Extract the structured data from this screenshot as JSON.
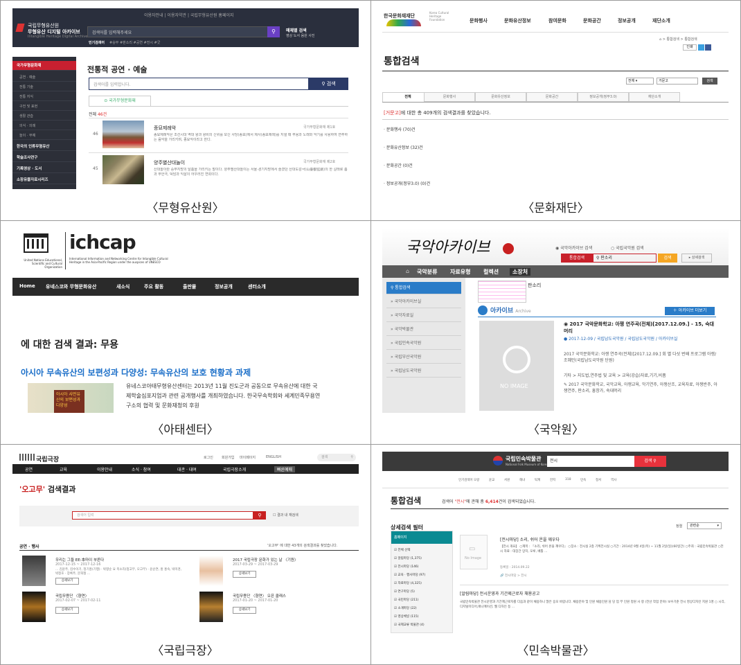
{
  "captions": {
    "p1": "〈무형유산원〉",
    "p2": "〈문화재단〉",
    "p3": "〈아태센터〉",
    "p4": "〈국악원〉",
    "p5": "〈국립극장〉",
    "p6": "〈민속박물관〉"
  },
  "p1": {
    "topbar": "이용자안내 | 이용자약관 | 국립무형유산원 홈페이지",
    "logo_line1": "국립무형유산원",
    "logo_line2": "무형유산 디지털 아카이브",
    "logo_line3": "Intangible Heritage Digital Archive",
    "search_placeholder": "검색어를 입력해주세요",
    "type_title": "매체별 검색",
    "type_items": "영상  도서  음원  사진",
    "popular_label": "인기검색어",
    "popular_items": "#승무  #판소리  #공연  #전시  #굿",
    "side_items": [
      "국가무형문화재",
      "공연 · 예술",
      "전통 기술",
      "전통 지식",
      "구전 및 표현",
      "생활 관습",
      "의식 · 의례",
      "놀이 · 무예",
      "한국의 인류무형유산",
      "학술조사연구",
      "기록영상 · 도서",
      "소장유물자료시리즈"
    ],
    "section_title": "전통적 공연 · 예술",
    "search2_placeholder": "검색어를 입력합니다.",
    "search2_button": "검색",
    "tab": "국가무형문화재",
    "total": "전체 46건",
    "item1_title": "종묘제례악",
    "item1_tag": "국가무형문화재 제1호",
    "item1_desc": "종묘제례악은 조선시대 역대 왕과 왕비의 신위를 모신 사당(종묘)에서 제사(종묘제례)를 지낼 때 무용과 노래와 악기를 사용하여 연주하는 음악을 가리키며, 종묘악이라고 한다.",
    "item1_num": "46",
    "item2_title": "양주별산대놀이",
    "item2_tag": "국가무형문화재 제2호",
    "item2_desc": "산대놀이란 중부지방의 탈춤을 가리키는 말이다. 양주별산대놀이는 서울·경기지방에서 즐겼던 산대도감극(山臺都監劇)의 한 갈래로 춤과 무언극, 덕담과 익살이 어우러진 연희이다.",
    "item2_num": "45"
  },
  "p2": {
    "logo": "한국문화재재단",
    "logo_sub": "Korea Cultural Heritage Foundation",
    "nav": [
      "문화행사",
      "문화유산정보",
      "참여문화",
      "문화공간",
      "정보공개",
      "재단소개"
    ],
    "breadcrumb": "통합검색 > 통합검색",
    "print": "인쇄",
    "title": "통합검색",
    "select": "전체",
    "query": "거문고",
    "search_button": "검색",
    "tabs": [
      "전체",
      "문화행사",
      "문화유산정보",
      "문화공간",
      "정보공개(정부3.0)",
      "재단소개"
    ],
    "result_prefix": "[거문고]",
    "result_text": "에 대한 총 409개의 검색결과를 찾았습니다.",
    "cats": [
      "문화행사 (70)건",
      "문화유산정보 (32)건",
      "문화공간 (0)건",
      "정보공개(정부3.0) (0)건"
    ]
  },
  "p3": {
    "unesco_caption": "United Nations Educational, Scientific and Cultural Organization",
    "logo": "ichcap",
    "logo_desc": "International Information and Networking Centre for Intangible Cultural Heritage in the Asia-Pacific Region under the auspices of UNESCO",
    "nav": [
      "Home",
      "유네스코와 무형문화유산",
      "새소식",
      "주요 활동",
      "출판물",
      "정보공개",
      "센터소개"
    ],
    "result": "에 대한 검색 결과: 무용",
    "article_title": "아시아 무속유산의 보편성과 다양성: 무속유산의 보호 현황과 과제",
    "article_text": "유네스코아태무형유산센터는 2013년 11월 진도군과 공동으로 무속유산에 대한 국제학술심포지엄과 관련 공개행사를 개최하였습니다. 한국무속학회와 세계민족무용연구소의 협력 및 문화재청의 후원",
    "thumb_text": "아시아 샤먼유산의 보편성과 다양성"
  },
  "p4": {
    "logo": "국악아카이브",
    "radio1": "국악아카이브 검색",
    "radio2": "국립국악원 검색",
    "search_label": "통합검색",
    "query": "판소리",
    "search_button": "검색",
    "detail_button": "상세검색",
    "nav": [
      "국악분류",
      "자료유형",
      "컬렉션",
      "소장처"
    ],
    "side": [
      "통합검색",
      "국악아카이브실",
      "국악자료실",
      "국악박물관",
      "국립민속국악원",
      "국립부산국악원",
      "국립남도국악원"
    ],
    "query_show": "판소리",
    "archive_title": "아카이브",
    "archive_sub": "Archive",
    "more_button": "아카이브 더보기",
    "item_title": "2017 국악문화학교: 아쟁 연주곡(전체)[2017.12.09.] - 15, 숙대머리",
    "item_meta": "2017-12-09 / 국립남도국악원 / 국립남도국악원 / 아카이브실",
    "item_desc": "2017 국악문화학교: 아쟁 연주곡(전체)[2017.12.09.] 회 별 다섯 번째 프로그램 아쟁/조혜민(국립남도국악원 단원)",
    "item_path": "기타 > 지도법,연주법 및 교육 > 교육(강습)자료,기기,비품",
    "item_tags": "2017 국악문화학교, 국악교육, 아쟁교육, 악기연주, 아쟁산조, 교육자료, 아쟁반주, 아쟁연주, 판소리, 흥창가, 숙대머리",
    "no_image": "NO IMAGE"
  },
  "p5": {
    "logo": "국립극장",
    "links": [
      "로그인",
      "회원가입",
      "마이페이지",
      "ENGLISH"
    ],
    "top_search": "검색",
    "nav": [
      "공연",
      "교육",
      "이용안내",
      "소식 · 참여",
      "대관 · 대여",
      "국립극장소개",
      "빠른예매"
    ],
    "title_q": "'오고무'",
    "title_rest": " 검색결과",
    "search_placeholder": "검색어 입력",
    "within": "결과 내 재검색",
    "section": "공연 · 행사",
    "found": "'오고무' 에 대한 43개의 검색결과를 찾았습니다.",
    "items": [
      {
        "title": "우리는 그들 EE:本마이 부른다",
        "date": "2017-12-15 ~ 2017-12-16",
        "desc": "... 김윤주, 김수이기, 정기흥(기행) · 박향순 요 목소리(청고무, 오고무) · 윤순연, 홍 홍숙, 박미경, 박정호 · 장록주, 문희철 ...",
        "btn": "상세보기"
      },
      {
        "title": "2017 국립극장 문화가 있는 날 〈기원〉",
        "date": "2017-03-29 ~ 2017-03-29",
        "desc": "",
        "btn": "상세보기"
      },
      {
        "title": "국립무용단 〈향연〉",
        "date": "2017-02-07 ~ 2017-02-11",
        "desc": "",
        "btn": "상세보기"
      },
      {
        "title": "국립무용단 〈향연〉 오픈 클래스",
        "date": "2017-01-20 ~ 2017-01-20",
        "desc": "",
        "btn": "상세보기"
      }
    ]
  },
  "p6": {
    "logo": "국립민속박물관",
    "logo_sub": "National Folk Museum of Korea",
    "query": "전시",
    "search_button": "검색",
    "nav": [
      "인기검색어",
      "오랑",
      "윤교",
      "서원",
      "해녀",
      "탁계",
      "한지",
      "318",
      "민속",
      "정서",
      "역사"
    ],
    "title": "통합검색",
    "result_a": "검색어 ",
    "result_q": "\"전시\"",
    "result_b": "에 관해 총 ",
    "result_n": "6,414",
    "result_c": "건이 검색되었습니다.",
    "sort_label": "정렬",
    "sort_value": "관련순",
    "filter_title": "상세검색 필터",
    "filter_head": "홈페이지",
    "filters": [
      "전체 선택",
      "알림마당 (1,375)",
      "전시마당 (146)",
      "교육 · 행사마당 (97)",
      "자료마당 (4,325)",
      "연구마당 (5)",
      "국민마당 (211)",
      "소개마당 (22)",
      "영상체널 (115)",
      "국제교류 박물관 (4)"
    ],
    "r1_title": "[전시마당] 소리, 쉬어 온을 깨우다",
    "r1_desc": "【전시 개요】 ○제목 : 『소리, 쉬어 온을 깨우다』 ○장소 : 전시실 2층 기획전시실 ○기간 : 2014년 9월 4일(목) ~ 11월 2일(일)(60일간) ○주최 : 국립민속박물관 ○전시 자료 : 대장간 망치, 모루, 베틀 ...",
    "r1_date": "등록일 : 2014.09.22",
    "r1_link": "전시마당 > 전시",
    "no_image": "No Image",
    "r2_title": "[알림마당] 전시운영과 기간제근로자 채용공고",
    "r2_desc": "국립민속박물관 전시운영과 기간제근로자를 다음과 같이 채용하니 많은 응모 바랍니다. 채용분야 및 인원 채용인원 담 당 업 무 인원 정원 사 항 (전산 작업 분야) 보수기준 전시 영상디자인 지원 1명 ○ 시각,디지털미디어,애니메이션, 웹 디자인 등 ..."
  }
}
